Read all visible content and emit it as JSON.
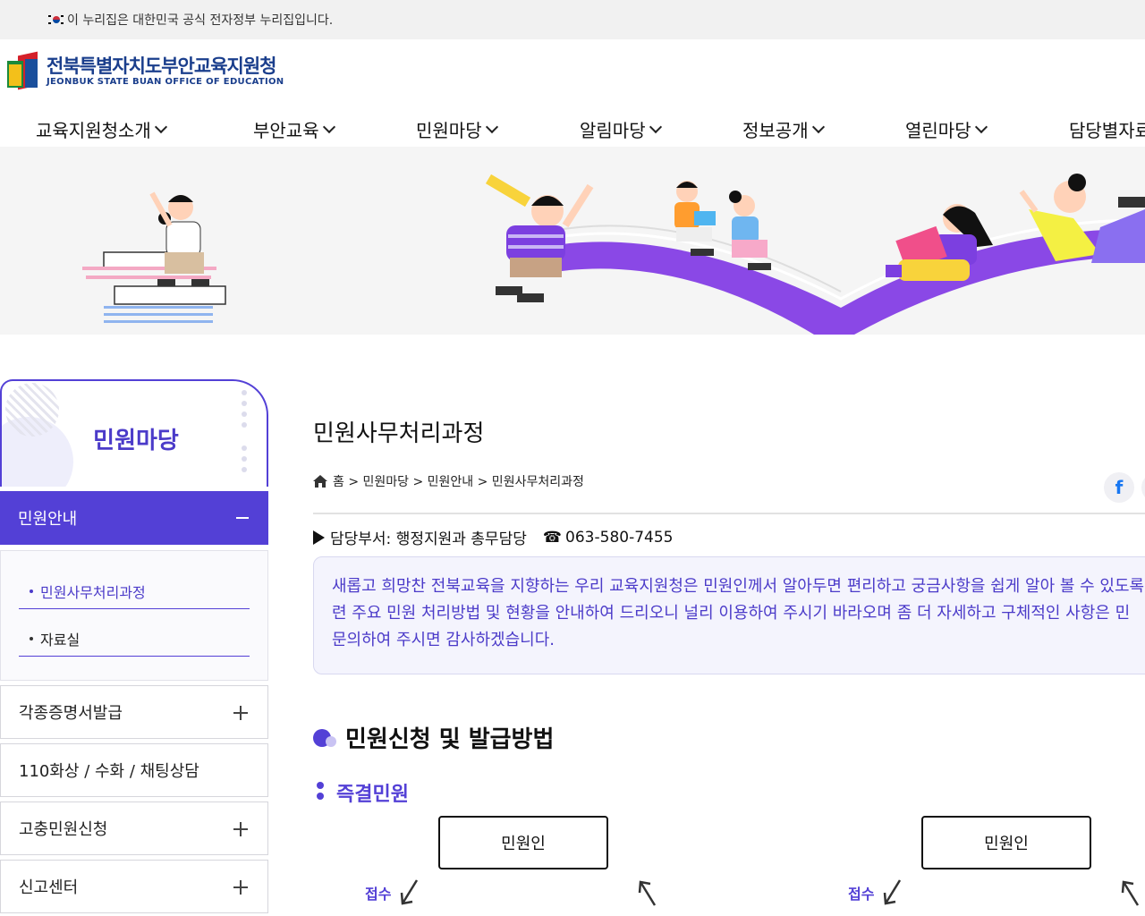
{
  "gov_notice": "이 누리집은 대한민국 공식 전자정부 누리집입니다.",
  "logo": {
    "name_ko": "전북특별자치도부안교육지원청",
    "name_en": "JEONBUK STATE BUAN OFFICE OF EDUCATION"
  },
  "nav": [
    {
      "label": "교육지원청소개"
    },
    {
      "label": "부안교육"
    },
    {
      "label": "민원마당"
    },
    {
      "label": "알림마당"
    },
    {
      "label": "정보공개"
    },
    {
      "label": "열린마당"
    },
    {
      "label": "담당별자료"
    }
  ],
  "sidebar": {
    "title": "민원마당",
    "active": "민원안내",
    "sub_items": [
      {
        "label": "민원사무처리과정",
        "current": true
      },
      {
        "label": "자료실",
        "current": false
      }
    ],
    "menus": [
      {
        "label": "각종증명서발급",
        "expandable": true
      },
      {
        "label": "110화상 / 수화 / 채팅상담",
        "expandable": false
      },
      {
        "label": "고충민원신청",
        "expandable": true
      },
      {
        "label": "신고센터",
        "expandable": true
      }
    ]
  },
  "content": {
    "title": "민원사무처리과정",
    "breadcrumb": "홈 > 민원마당 > 민원안내 > 민원사무처리과정",
    "dept_label": "담당부서: 행정지원과 총무담당",
    "phone": "063-580-7455",
    "intro_lines": [
      "새롭고 희망찬 전북교육을 지향하는 우리 교육지원청은 민원인께서 알아두면 편리하고 궁금사항을 쉽게 알아 볼 수 있도록",
      "련 주요 민원 처리방법 및 현황을 안내하여 드리오니 널리 이용하여 주시기 바라오며 좀 더 자세하고 구체적인 사항은 민",
      "문의하여 주시면 감사하겠습니다."
    ],
    "section_title": "민원신청 및 발급방법",
    "subsection_title": "즉결민원",
    "flow": [
      {
        "box": "민원인",
        "label": "접수"
      },
      {
        "box": "민원인",
        "label": "접수"
      }
    ]
  },
  "colors": {
    "accent": "#5340d6",
    "accent_light": "#f4f4fd",
    "brand_blue": "#1a3e8c"
  }
}
